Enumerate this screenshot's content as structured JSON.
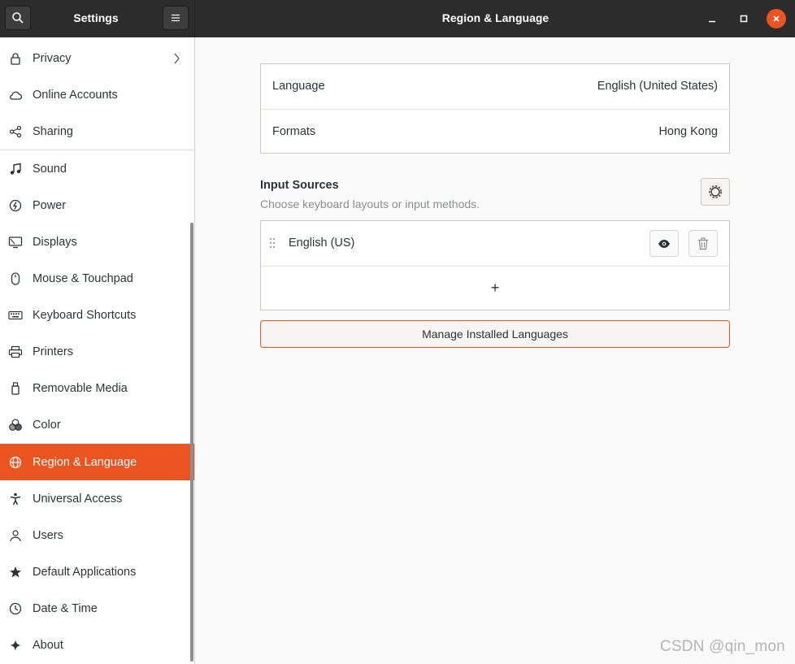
{
  "header": {
    "app_title": "Settings",
    "page_title": "Region & Language",
    "icons": {
      "search": "search-icon",
      "menu": "hamburger-menu-icon",
      "minimize": "minimize-icon",
      "maximize": "maximize-icon",
      "close": "close-icon"
    }
  },
  "sidebar": {
    "active": "Region & Language",
    "items": [
      {
        "label": "Privacy",
        "icon": "lock-icon"
      },
      {
        "label": "Online Accounts",
        "icon": "cloud-icon"
      },
      {
        "label": "Sharing",
        "icon": "share-icon"
      },
      {
        "label": "Sound",
        "icon": "music-note-icon"
      },
      {
        "label": "Power",
        "icon": "power-icon"
      },
      {
        "label": "Displays",
        "icon": "display-icon"
      },
      {
        "label": "Mouse & Touchpad",
        "icon": "mouse-icon"
      },
      {
        "label": "Keyboard Shortcuts",
        "icon": "keyboard-icon"
      },
      {
        "label": "Printers",
        "icon": "printer-icon"
      },
      {
        "label": "Removable Media",
        "icon": "usb-icon"
      },
      {
        "label": "Color",
        "icon": "color-icon"
      },
      {
        "label": "Region & Language",
        "icon": "globe-icon"
      },
      {
        "label": "Universal Access",
        "icon": "accessibility-icon"
      },
      {
        "label": "Users",
        "icon": "users-icon"
      },
      {
        "label": "Default Applications",
        "icon": "star-icon"
      },
      {
        "label": "Date & Time",
        "icon": "clock-icon"
      },
      {
        "label": "About",
        "icon": "sparkle-icon"
      }
    ]
  },
  "main": {
    "language_row": {
      "label": "Language",
      "value": "English (United States)"
    },
    "formats_row": {
      "label": "Formats",
      "value": "Hong Kong"
    },
    "input_sources": {
      "title": "Input Sources",
      "subtitle": "Choose keyboard layouts or input methods.",
      "items": [
        {
          "label": "English (US)"
        }
      ],
      "add_label": "+"
    },
    "manage_button": "Manage Installed Languages"
  },
  "colors": {
    "accent": "#e95420",
    "header_bg": "#2c2c2c",
    "sidebar_bg": "#ffffff",
    "content_bg": "#fafafa"
  },
  "watermark": "CSDN @qin_mon"
}
